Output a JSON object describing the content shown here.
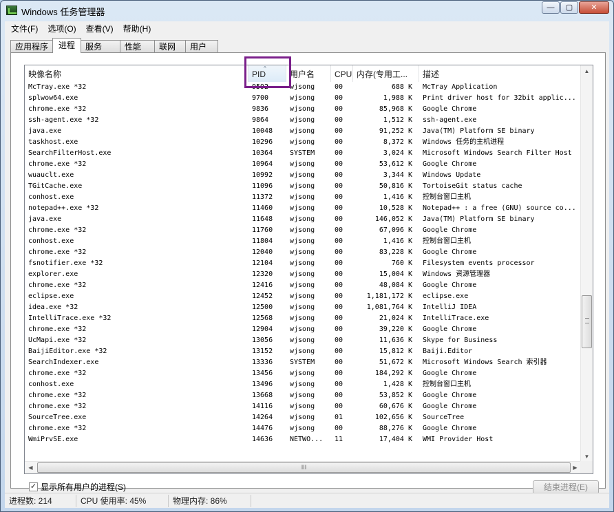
{
  "window": {
    "title": "Windows 任务管理器",
    "controls": {
      "minimize": "—",
      "maximize": "▢",
      "close": "✕"
    }
  },
  "menu": [
    "文件(F)",
    "选项(O)",
    "查看(V)",
    "帮助(H)"
  ],
  "tabs": [
    "应用程序",
    "进程",
    "服务",
    "性能",
    "联网",
    "用户"
  ],
  "active_tab": "进程",
  "columns": [
    "映像名称",
    "PID",
    "用户名",
    "CPU",
    "内存(专用工...",
    "描述"
  ],
  "sort_indicator": "^",
  "rows": [
    [
      "McTray.exe *32",
      "9592",
      "wjsong",
      "00",
      "688 K",
      "McTray Application"
    ],
    [
      "splwow64.exe",
      "9700",
      "wjsong",
      "00",
      "1,988 K",
      "Print driver host for 32bit applic..."
    ],
    [
      "chrome.exe *32",
      "9836",
      "wjsong",
      "00",
      "85,968 K",
      "Google Chrome"
    ],
    [
      "ssh-agent.exe *32",
      "9864",
      "wjsong",
      "00",
      "1,512 K",
      "ssh-agent.exe"
    ],
    [
      "java.exe",
      "10048",
      "wjsong",
      "00",
      "91,252 K",
      "Java(TM) Platform SE binary"
    ],
    [
      "taskhost.exe",
      "10296",
      "wjsong",
      "00",
      "8,372 K",
      "Windows 任务的主机进程"
    ],
    [
      "SearchFilterHost.exe",
      "10364",
      "SYSTEM",
      "00",
      "3,024 K",
      "Microsoft Windows Search Filter Host"
    ],
    [
      "chrome.exe *32",
      "10964",
      "wjsong",
      "00",
      "53,612 K",
      "Google Chrome"
    ],
    [
      "wuauclt.exe",
      "10992",
      "wjsong",
      "00",
      "3,344 K",
      "Windows Update"
    ],
    [
      "TGitCache.exe",
      "11096",
      "wjsong",
      "00",
      "50,816 K",
      "TortoiseGit status cache"
    ],
    [
      "conhost.exe",
      "11372",
      "wjsong",
      "00",
      "1,416 K",
      "控制台窗口主机"
    ],
    [
      "notepad++.exe *32",
      "11460",
      "wjsong",
      "00",
      "10,528 K",
      "Notepad++ : a free (GNU) source co..."
    ],
    [
      "java.exe",
      "11648",
      "wjsong",
      "00",
      "146,052 K",
      "Java(TM) Platform SE binary"
    ],
    [
      "chrome.exe *32",
      "11760",
      "wjsong",
      "00",
      "67,096 K",
      "Google Chrome"
    ],
    [
      "conhost.exe",
      "11804",
      "wjsong",
      "00",
      "1,416 K",
      "控制台窗口主机"
    ],
    [
      "chrome.exe *32",
      "12040",
      "wjsong",
      "00",
      "83,228 K",
      "Google Chrome"
    ],
    [
      "fsnotifier.exe *32",
      "12104",
      "wjsong",
      "00",
      "760 K",
      "Filesystem events processor"
    ],
    [
      "explorer.exe",
      "12320",
      "wjsong",
      "00",
      "15,004 K",
      "Windows 资源管理器"
    ],
    [
      "chrome.exe *32",
      "12416",
      "wjsong",
      "00",
      "48,084 K",
      "Google Chrome"
    ],
    [
      "eclipse.exe",
      "12452",
      "wjsong",
      "00",
      "1,181,172 K",
      "eclipse.exe"
    ],
    [
      "idea.exe *32",
      "12500",
      "wjsong",
      "00",
      "1,081,764 K",
      "IntelliJ IDEA"
    ],
    [
      "IntelliTrace.exe *32",
      "12568",
      "wjsong",
      "00",
      "21,024 K",
      "IntelliTrace.exe"
    ],
    [
      "chrome.exe *32",
      "12904",
      "wjsong",
      "00",
      "39,220 K",
      "Google Chrome"
    ],
    [
      "UcMapi.exe *32",
      "13056",
      "wjsong",
      "00",
      "11,636 K",
      "Skype for Business"
    ],
    [
      "BaijiEditor.exe *32",
      "13152",
      "wjsong",
      "00",
      "15,812 K",
      "Baiji.Editor"
    ],
    [
      "SearchIndexer.exe",
      "13336",
      "SYSTEM",
      "00",
      "51,672 K",
      "Microsoft Windows Search 索引器"
    ],
    [
      "chrome.exe *32",
      "13456",
      "wjsong",
      "00",
      "184,292 K",
      "Google Chrome"
    ],
    [
      "conhost.exe",
      "13496",
      "wjsong",
      "00",
      "1,428 K",
      "控制台窗口主机"
    ],
    [
      "chrome.exe *32",
      "13668",
      "wjsong",
      "00",
      "53,852 K",
      "Google Chrome"
    ],
    [
      "chrome.exe *32",
      "14116",
      "wjsong",
      "00",
      "60,676 K",
      "Google Chrome"
    ],
    [
      "SourceTree.exe",
      "14264",
      "wjsong",
      "01",
      "102,656 K",
      "SourceTree"
    ],
    [
      "chrome.exe *32",
      "14476",
      "wjsong",
      "00",
      "88,276 K",
      "Google Chrome"
    ],
    [
      "WmiPrvSE.exe",
      "14636",
      "NETWO...",
      "11",
      "17,404 K",
      "WMI Provider Host"
    ]
  ],
  "scrollbar": {
    "up": "▲",
    "down": "▼",
    "left": "◀",
    "right": "▶",
    "grip": "III"
  },
  "show_all_label": "显示所有用户的进程(S)",
  "show_all_checked": "✓",
  "end_process_label": "结束进程(E)",
  "status": {
    "processes": "进程数: 214",
    "cpu": "CPU 使用率: 45%",
    "memory": "物理内存: 86%"
  }
}
